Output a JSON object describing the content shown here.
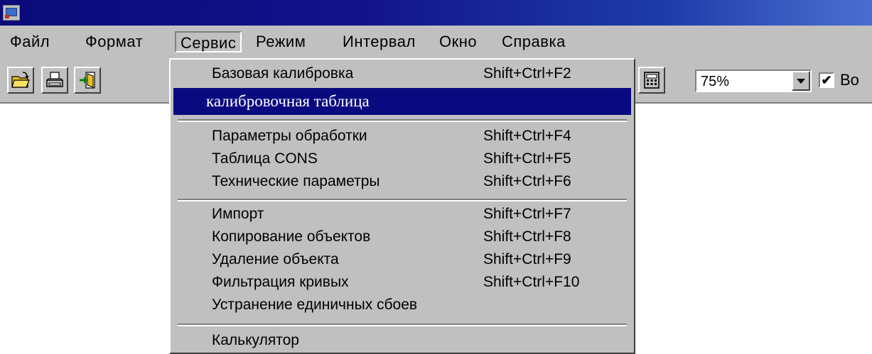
{
  "window": {
    "icon": "app-icon"
  },
  "menubar": {
    "items": [
      {
        "label": "Файл"
      },
      {
        "label": "Формат"
      },
      {
        "label": "Сервис"
      },
      {
        "label": "Режим"
      },
      {
        "label": "Интервал"
      },
      {
        "label": "Окно"
      },
      {
        "label": "Справка"
      }
    ]
  },
  "toolbar": {
    "buttons": [
      {
        "icon": "open-folder-icon"
      },
      {
        "icon": "print-icon"
      },
      {
        "icon": "exit-icon"
      },
      {
        "icon": "calculator-icon"
      }
    ],
    "zoom": {
      "value": "75%"
    },
    "checkbox": {
      "checked": true,
      "label": "Bo"
    }
  },
  "service_menu": {
    "items": [
      {
        "label": "Базовая калибровка",
        "shortcut": "Shift+Ctrl+F2"
      },
      {
        "label": "калибровочная таблица",
        "shortcut": ""
      },
      {
        "label": "Параметры обработки",
        "shortcut": "Shift+Ctrl+F4"
      },
      {
        "label": "Таблица CONS",
        "shortcut": "Shift+Ctrl+F5"
      },
      {
        "label": "Технические параметры",
        "shortcut": "Shift+Ctrl+F6"
      },
      {
        "label": "Импорт",
        "shortcut": "Shift+Ctrl+F7"
      },
      {
        "label": "Копирование объектов",
        "shortcut": "Shift+Ctrl+F8"
      },
      {
        "label": "Удаление объекта",
        "shortcut": "Shift+Ctrl+F9"
      },
      {
        "label": "Фильтрация кривых",
        "shortcut": "Shift+Ctrl+F10"
      },
      {
        "label": "Устранение единичных сбоев",
        "shortcut": ""
      },
      {
        "label": "Калькулятор",
        "shortcut": ""
      }
    ]
  },
  "colors": {
    "titlebar": "#0a0a7a",
    "highlight": "#0a0a80",
    "face": "#c0c0c0"
  }
}
